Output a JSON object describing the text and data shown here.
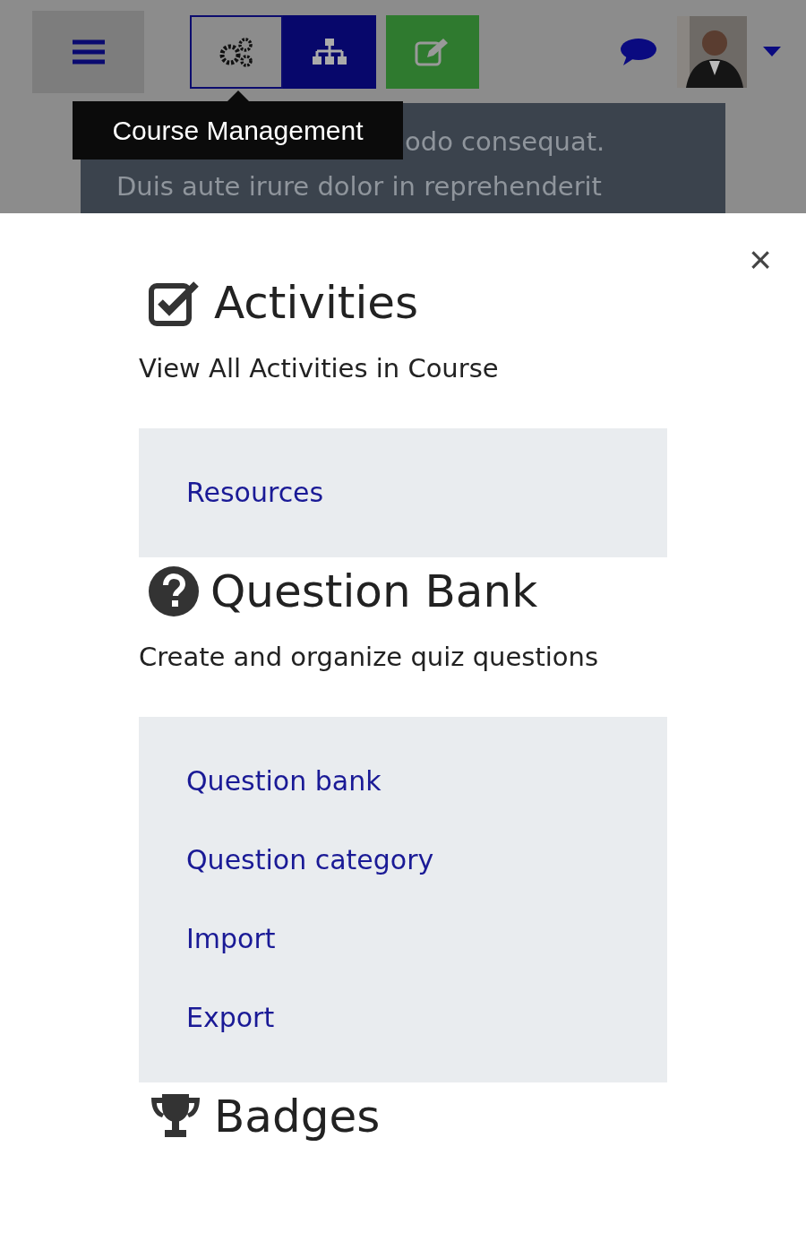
{
  "header": {
    "tooltip": "Course Management",
    "buttons": [
      {
        "kind": "gears",
        "selected": true
      },
      {
        "kind": "sitemap",
        "selected": false
      },
      {
        "kind": "edit",
        "selected": false
      }
    ]
  },
  "background_text": [
    "odo consequat.",
    "Duis aute irure dolor in reprehenderit"
  ],
  "drawer": {
    "close": "×",
    "sections": [
      {
        "kind": "check",
        "title": "Activities",
        "description": "View All Activities in Course",
        "links": [
          "Resources"
        ]
      },
      {
        "kind": "question",
        "title": "Question Bank",
        "description": "Create and organize quiz questions",
        "links": [
          "Question bank",
          "Question category",
          "Import",
          "Export"
        ]
      },
      {
        "kind": "trophy",
        "title": "Badges"
      }
    ]
  }
}
